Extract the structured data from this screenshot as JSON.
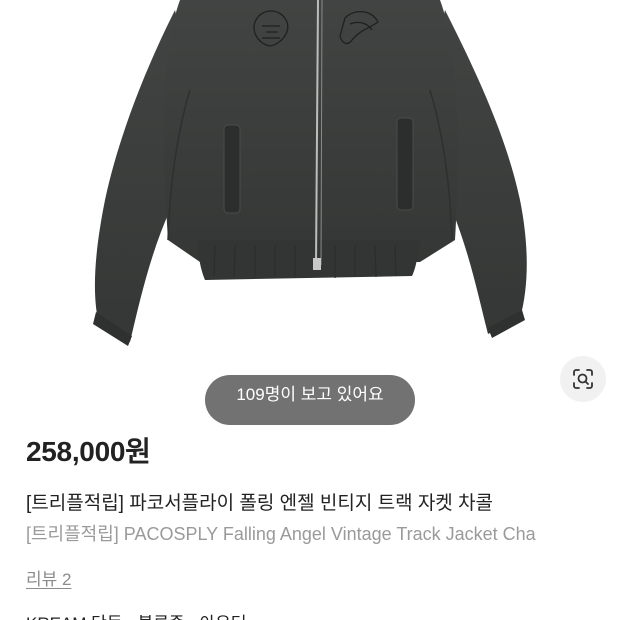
{
  "product": {
    "price": "258,000원",
    "title_ko": "[트리플적립] 파코서플라이 폴링 엔젤 빈티지 트랙 자켓 차콜",
    "title_en_main": "[트리플적립] PACOSPLY Falling Angel Vintage Track Jacket Cha",
    "title_en_fade": "",
    "reviews_label": "리뷰 2"
  },
  "overlay": {
    "viewers_text": "109명이 보고 있어요"
  },
  "footer": {
    "partial_text": "KREAM 단독 · 블루종 · 아우터"
  },
  "colors": {
    "jacket": "#3a3c3b",
    "pill": "#3c3c3c",
    "price": "#222222",
    "subtitle": "#9a9a9a"
  },
  "icons": {
    "lens": "visual-search-icon"
  }
}
